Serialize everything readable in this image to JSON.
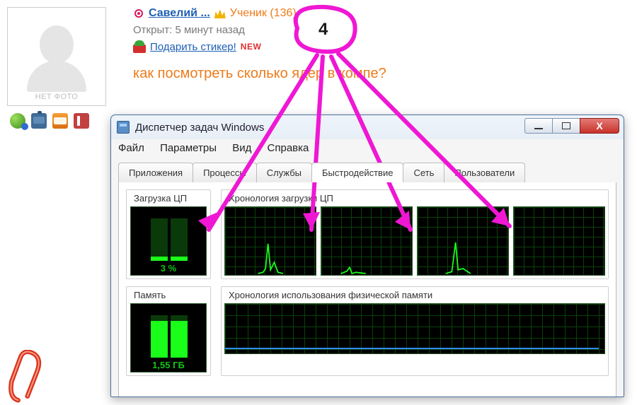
{
  "profile": {
    "no_photo": "НЕТ ФОТО",
    "username": "Савелий ...",
    "rank_label": "Ученик",
    "rank_points": "(136)",
    "open_label": "Открыт:",
    "open_time": "5 минут назад",
    "gift_link": "Подарить стикер!",
    "new_badge": "NEW",
    "question": "как посмотреть сколько ядер в компе?"
  },
  "annotation": {
    "number": "4"
  },
  "taskmgr": {
    "title": "Диспетчер задач Windows",
    "menus": [
      "Файл",
      "Параметры",
      "Вид",
      "Справка"
    ],
    "tabs": [
      "Приложения",
      "Процессы",
      "Службы",
      "Быстродействие",
      "Сеть",
      "Пользователи"
    ],
    "active_tab_index": 3,
    "cpu_group": "Загрузка ЦП",
    "cpu_value": "3 %",
    "cpu_hist_group": "Хронология загрузки ЦП",
    "mem_group": "Память",
    "mem_value": "1,55 ГБ",
    "mem_hist_group": "Хронология использования физической памяти"
  },
  "colors": {
    "accent_orange": "#ee7b1a",
    "link_blue": "#1e5fb3",
    "annotation_magenta": "#ef17d4",
    "graph_green": "#1aff1a"
  }
}
